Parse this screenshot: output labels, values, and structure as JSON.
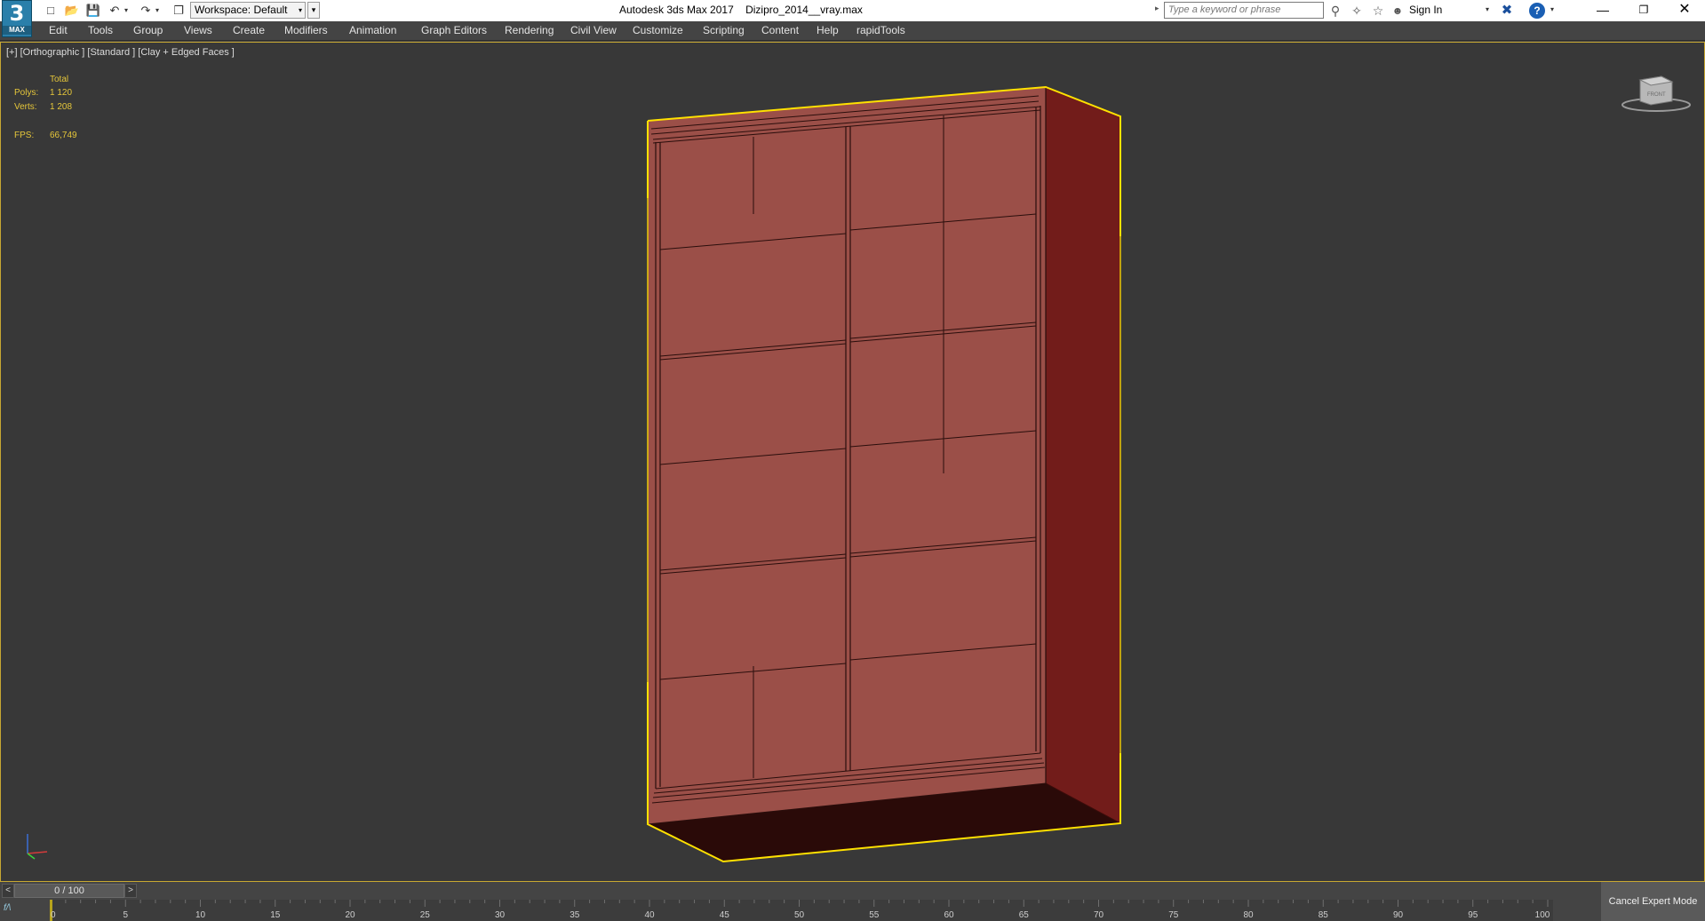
{
  "titlebar": {
    "logo_number": "3",
    "logo_text": "MAX",
    "workspace_label": "Workspace: Default",
    "window_title": "Autodesk 3ds Max 2017    Dizipro_2014__vray.max",
    "search_placeholder": "Type a keyword or phrase",
    "sign_in": "Sign In",
    "help": "?"
  },
  "menu": {
    "items": [
      "Edit",
      "Tools",
      "Group",
      "Views",
      "Create",
      "Modifiers",
      "Animation",
      "Graph Editors",
      "Rendering",
      "Civil View",
      "Customize",
      "Scripting",
      "Content",
      "Help",
      "rapidTools"
    ]
  },
  "viewport": {
    "label": "[+] [Orthographic ] [Standard ] [Clay + Edged Faces ]",
    "stats": {
      "total_label": "Total",
      "polys_label": "Polys:",
      "polys_value": "1 120",
      "verts_label": "Verts:",
      "verts_value": "1 208",
      "fps_label": "FPS:",
      "fps_value": "66,749"
    },
    "viewcube_label": "FRONT",
    "colors": {
      "background": "#383838",
      "selection": "#ffe100",
      "front_face": "#9b4f48",
      "side_face": "#721c1a",
      "bottom_face": "#2a0a08"
    }
  },
  "timeline": {
    "frame_display": "0 / 100",
    "ticks": [
      "0",
      "5",
      "10",
      "15",
      "20",
      "25",
      "30",
      "35",
      "40",
      "45",
      "50",
      "55",
      "60",
      "65",
      "70",
      "75",
      "80",
      "85",
      "90",
      "95",
      "100"
    ],
    "cancel_expert_mode": "Cancel Expert Mode"
  }
}
